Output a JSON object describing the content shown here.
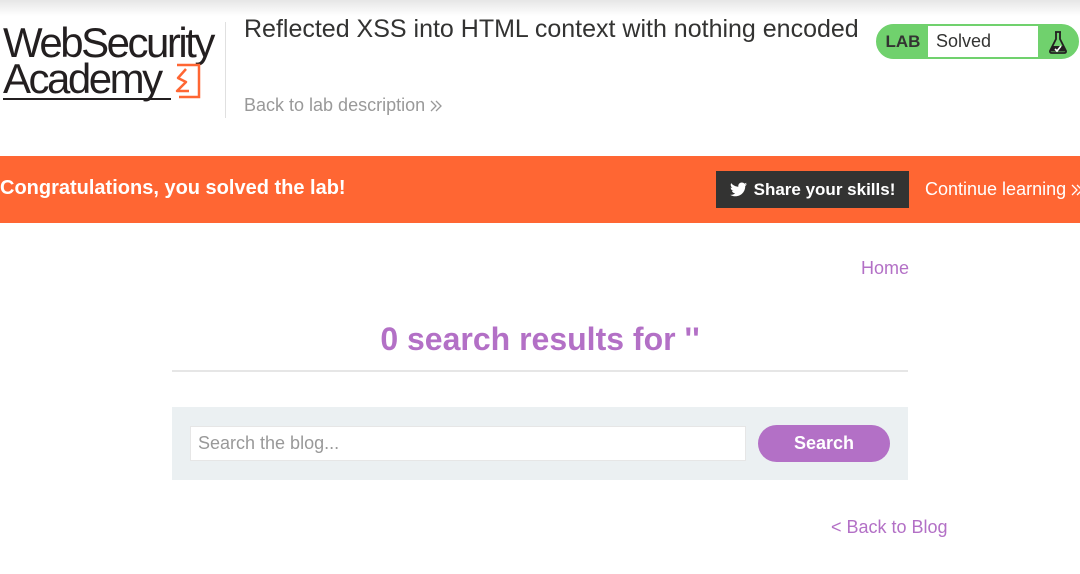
{
  "brand": {
    "logo_line1": "WebSecurity",
    "logo_line2": "Academy",
    "logo_mark_icon": "portswigger-lightning-icon",
    "text_color": "#231f20",
    "accent_color": "#ff6633"
  },
  "header": {
    "title": "Reflected XSS into HTML context with nothing encoded",
    "back_link_label": "Back to lab description",
    "back_link_icon": "double-chevron-right-icon"
  },
  "lab_status": {
    "badge_label": "LAB",
    "status": "Solved",
    "icon": "flask-check-icon",
    "color": "#70d16d"
  },
  "banner": {
    "message": "Congratulations, you solved the lab!",
    "share_button_label": "Share your skills!",
    "share_icon": "twitter-icon",
    "continue_label": "Continue learning",
    "continue_icon": "double-chevron-right-icon",
    "background_color": "#ff6633"
  },
  "nav": {
    "home_label": "Home"
  },
  "main": {
    "results_heading": "0 search results for ''",
    "heading_color": "#b370c6"
  },
  "search": {
    "placeholder": "Search the blog...",
    "value": "",
    "button_label": "Search",
    "button_color": "#b370c6",
    "panel_color": "#ebf0f2"
  },
  "footer_nav": {
    "back_to_blog_label": "< Back to Blog"
  }
}
